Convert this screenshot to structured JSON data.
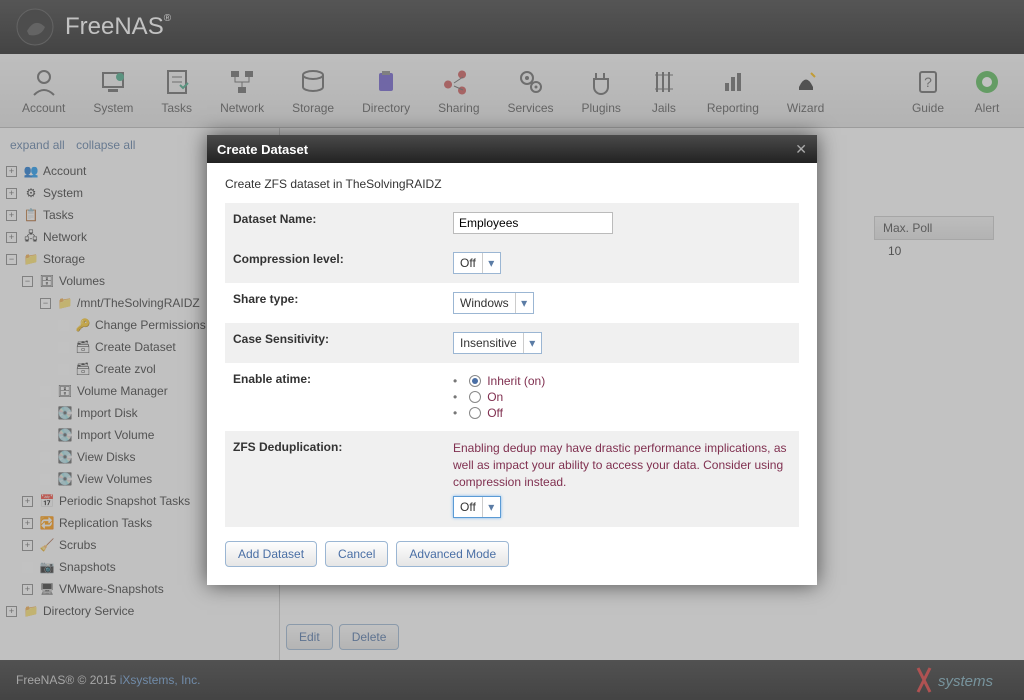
{
  "app": {
    "name": "FreeNAS",
    "reg": "®"
  },
  "toolbar": [
    {
      "label": "Account"
    },
    {
      "label": "System"
    },
    {
      "label": "Tasks"
    },
    {
      "label": "Network"
    },
    {
      "label": "Storage"
    },
    {
      "label": "Directory"
    },
    {
      "label": "Sharing"
    },
    {
      "label": "Services"
    },
    {
      "label": "Plugins"
    },
    {
      "label": "Jails"
    },
    {
      "label": "Reporting"
    },
    {
      "label": "Wizard"
    },
    {
      "label": "Guide"
    },
    {
      "label": "Alert"
    }
  ],
  "tree_actions": {
    "expand": "expand all",
    "collapse": "collapse all"
  },
  "tree": {
    "account": "Account",
    "system": "System",
    "tasks": "Tasks",
    "network": "Network",
    "storage": "Storage",
    "volumes": "Volumes",
    "mnt": "/mnt/TheSolvingRAIDZ",
    "chperm": "Change Permissions",
    "createds": "Create Dataset",
    "createzvol": "Create zvol",
    "volman": "Volume Manager",
    "impdisk": "Import Disk",
    "impvol": "Import Volume",
    "viewdisks": "View Disks",
    "viewvols": "View Volumes",
    "periodic": "Periodic Snapshot Tasks",
    "replication": "Replication Tasks",
    "scrubs": "Scrubs",
    "snapshots": "Snapshots",
    "vmware": "VMware-Snapshots",
    "dirservice": "Directory Service"
  },
  "grid": {
    "maxpoll_header": "Max. Poll",
    "maxpoll_value": "10"
  },
  "buttons": {
    "edit": "Edit",
    "delete": "Delete"
  },
  "footer": {
    "text": "FreeNAS® © 2015 ",
    "link": "iXsystems, Inc."
  },
  "modal": {
    "title": "Create Dataset",
    "desc": "Create ZFS dataset in TheSolvingRAIDZ",
    "labels": {
      "name": "Dataset Name:",
      "compression": "Compression level:",
      "share": "Share type:",
      "case": "Case Sensitivity:",
      "atime": "Enable atime:",
      "dedup": "ZFS Deduplication:"
    },
    "values": {
      "name": "Employees",
      "compression": "Off",
      "share": "Windows",
      "case": "Insensitive",
      "atime_inherit": "Inherit (on)",
      "atime_on": "On",
      "atime_off": "Off",
      "dedup_warn": "Enabling dedup may have drastic performance implications, as well as impact your ability to access your data. Consider using compression instead.",
      "dedup": "Off"
    },
    "actions": {
      "add": "Add Dataset",
      "cancel": "Cancel",
      "adv": "Advanced Mode"
    }
  }
}
